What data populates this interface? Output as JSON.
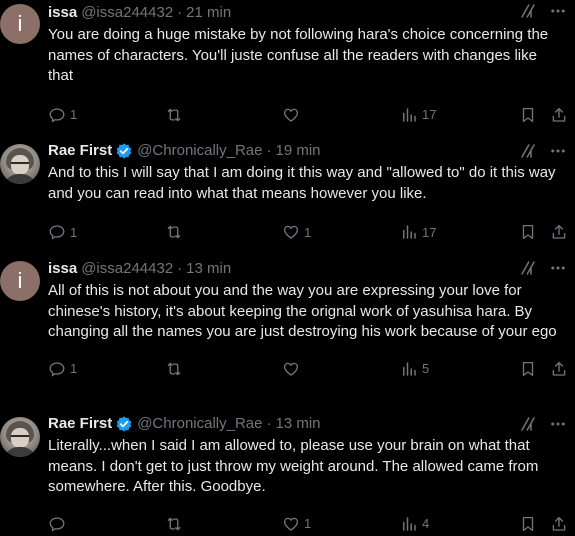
{
  "tweets": [
    {
      "avatar_initial": "i",
      "name": "issa",
      "verified": false,
      "handle": "@issa244432",
      "time": "21 min",
      "text": "You are doing a huge mistake by not following hara's choice concerning the names of characters. You'll juste confuse all the readers with changes like that",
      "replies": "1",
      "retweets": "",
      "likes": "",
      "views": "17"
    },
    {
      "avatar_initial": "",
      "name": "Rae First",
      "verified": true,
      "handle": "@Chronically_Rae",
      "time": "19 min",
      "text": "And to this I will say that I am doing it this way and \"allowed to\" do it this way and you can read into what that means however you like.",
      "replies": "1",
      "retweets": "",
      "likes": "1",
      "views": "17"
    },
    {
      "avatar_initial": "i",
      "name": "issa",
      "verified": false,
      "handle": "@issa244432",
      "time": "13 min",
      "text": "All of this is not about you and the way you are expressing your love for chinese's history, it's about keeping the orignal work of yasuhisa hara. By changing all the names you are just destroying his work because of your ego",
      "replies": "1",
      "retweets": "",
      "likes": "",
      "views": "5"
    },
    {
      "avatar_initial": "",
      "name": "Rae First",
      "verified": true,
      "handle": "@Chronically_Rae",
      "time": "13 min",
      "text": "Literally...when I said I am allowed to, please use your brain on what that means. I don't get to just throw my weight around. The allowed came from somewhere. After this. Goodbye.",
      "replies": "",
      "retweets": "",
      "likes": "1",
      "views": "4"
    }
  ],
  "separator": "·",
  "colors": {
    "background": "#000000",
    "text_primary": "#e7e9ea",
    "text_secondary": "#71767b",
    "verified_blue": "#1d9bf0",
    "avatar_issa": "#8c6f67"
  },
  "icons": {
    "reply": "reply-icon",
    "retweet": "retweet-icon",
    "like": "like-icon",
    "views": "views-icon",
    "bookmark": "bookmark-icon",
    "share": "share-icon",
    "grok": "grok-icon",
    "more": "more-icon",
    "verified": "verified-badge-icon"
  }
}
